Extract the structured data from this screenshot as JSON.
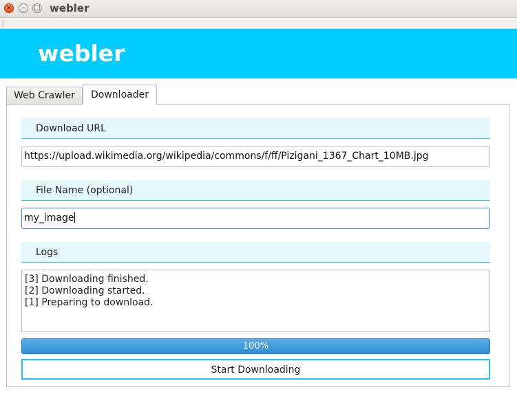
{
  "window": {
    "title": "webler",
    "close_glyph": "×",
    "minimize_glyph": "–",
    "maximize_glyph": "□"
  },
  "header": {
    "app_title": "webler",
    "background": "#00ccff"
  },
  "tabs": [
    {
      "label": "Web Crawler",
      "active": false
    },
    {
      "label": "Downloader",
      "active": true
    }
  ],
  "downloader": {
    "url_label": "Download URL",
    "url_value": "https://upload.wikimedia.org/wikipedia/commons/f/ff/Pizigani_1367_Chart_10MB.jpg",
    "filename_label": "File Name (optional)",
    "filename_value": "my_image",
    "logs_label": "Logs",
    "logs": [
      "[3] Downloading finished.",
      "[2] Downloading started.",
      "[1] Preparing to download."
    ],
    "progress": {
      "value": 100,
      "text": "100%"
    },
    "start_button": "Start Downloading"
  }
}
